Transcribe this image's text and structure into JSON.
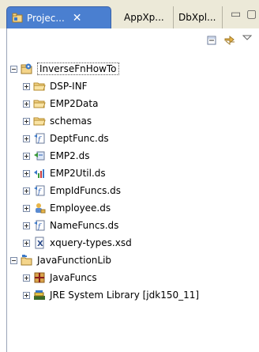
{
  "tabs": [
    {
      "label": "Projec...",
      "close": "✕",
      "active": true
    },
    {
      "label": "AppXp...",
      "active": false
    },
    {
      "label": "DbXpl...",
      "active": false
    }
  ],
  "window_buttons": {
    "minimize": "▭",
    "maximize": "▢"
  },
  "toolbar": {
    "collapse_icon": "collapse-all-icon",
    "link_icon": "link-with-editor-icon",
    "menu_icon": "view-menu-icon"
  },
  "tree": {
    "root1": {
      "label": "InverseFnHowTo",
      "expanded": true
    },
    "root1_children": [
      {
        "label": "DSP-INF",
        "icon": "folder-icon"
      },
      {
        "label": "EMP2Data",
        "icon": "folder-icon"
      },
      {
        "label": "schemas",
        "icon": "folder-icon"
      },
      {
        "label": "DeptFunc.ds",
        "icon": "function-ds-icon"
      },
      {
        "label": "EMP2.ds",
        "icon": "entity-ds-icon"
      },
      {
        "label": "EMP2Util.ds",
        "icon": "util-ds-icon"
      },
      {
        "label": "EmpIdFuncs.ds",
        "icon": "function-ds-icon"
      },
      {
        "label": "Employee.ds",
        "icon": "employee-ds-icon"
      },
      {
        "label": "NameFuncs.ds",
        "icon": "function-ds-icon"
      },
      {
        "label": "xquery-types.xsd",
        "icon": "xsd-icon"
      }
    ],
    "root2": {
      "label": "JavaFunctionLib",
      "expanded": true
    },
    "root2_children": [
      {
        "label": "JavaFuncs",
        "icon": "package-icon"
      },
      {
        "label": "JRE System Library [jdk150_11]",
        "icon": "library-icon"
      }
    ]
  }
}
